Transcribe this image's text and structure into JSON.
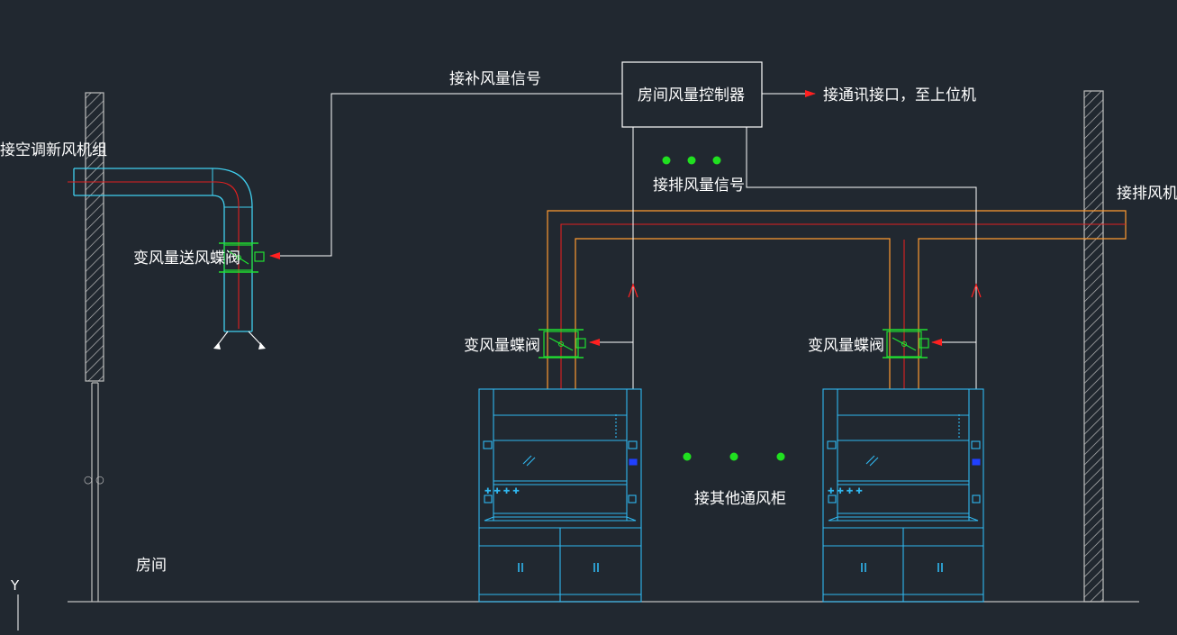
{
  "labels": {
    "fresh_air_unit": "接空调新风机组",
    "supply_air_signal": "接补风量信号",
    "room_controller": "房间风量控制器",
    "comm_port": "接通讯接口，至上位机",
    "exhaust_signal": "接排风量信号",
    "exhaust_fan": "接排风机",
    "vav_supply_damper": "变风量送风蝶阀",
    "vav_damper_left": "变风量蝶阀",
    "vav_damper_right": "变风量蝶阀",
    "other_hoods": "接其他通风柜",
    "room": "房间"
  },
  "axis": {
    "y": "Y"
  },
  "colors": {
    "background": "#212830",
    "wall_hatch": "#b0b0b0",
    "duct_supply": "#40d0f0",
    "duct_exhaust": "#ff9a30",
    "center_line": "#e02020",
    "damper": "#20e030",
    "signal_line": "#ffffff",
    "arrow": "#ff2020",
    "hood": "#30b8f0",
    "dots": "#20e020"
  },
  "icons": [
    "damper-icon",
    "actuator-icon",
    "signal-arrow-icon",
    "continuation-dots-icon",
    "fume-hood-icon",
    "wall-hatch-icon"
  ]
}
